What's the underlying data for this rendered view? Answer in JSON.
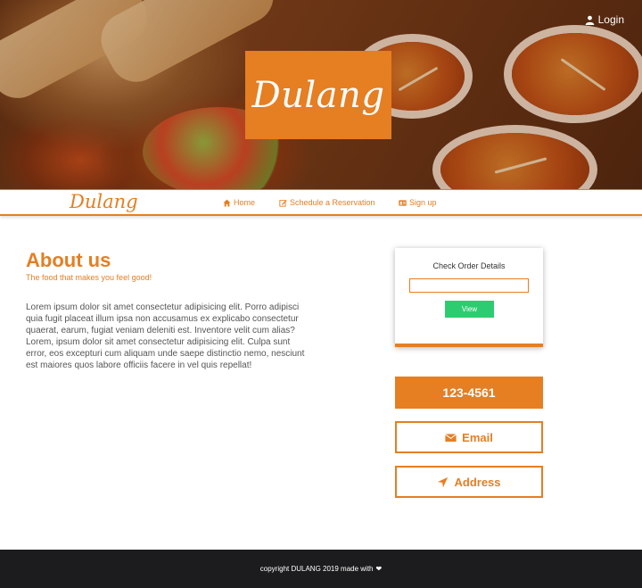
{
  "hero": {
    "logo_text": "Dulang",
    "login_label": "Login"
  },
  "navbar": {
    "brand": "Dulang",
    "items": [
      {
        "label": "Home",
        "icon": "home-icon"
      },
      {
        "label": "Schedule a Reservation",
        "icon": "edit-icon"
      },
      {
        "label": "Sign up",
        "icon": "id-card-icon"
      }
    ]
  },
  "about": {
    "title": "About us",
    "subtitle": "The food that makes you feel good!",
    "body": "Lorem ipsum dolor sit amet consectetur adipisicing elit. Porro adipisci quia fugit placeat illum ipsa non accusamus ex explicabo consectetur quaerat, earum, fugiat veniam deleniti est. Inventore velit cum alias? Lorem, ipsum dolor sit amet consectetur adipisicing elit. Culpa sunt error, eos excepturi cum aliquam unde saepe distinctio nemo, nesciunt est maiores quos labore officiis facere in vel quis repellat!"
  },
  "order": {
    "title": "Check Order Details",
    "input_value": "",
    "button_label": "View"
  },
  "contact": {
    "phone": "123-4561",
    "email_label": "Email",
    "address_label": "Address"
  },
  "footer": {
    "text": "copyright DULANG 2019 made with",
    "heart_icon": "heart-icon"
  },
  "colors": {
    "accent": "#e67e22",
    "view_button": "#2ecc71",
    "footer_bg": "#1c1c1e"
  }
}
